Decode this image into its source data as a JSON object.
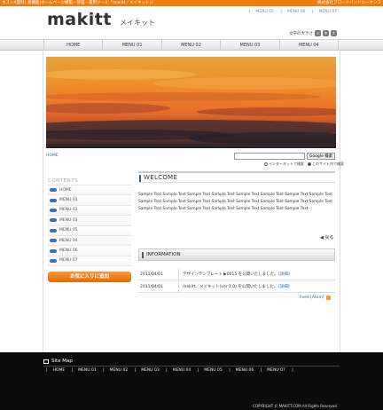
{
  "topbar": {
    "left": "ホスト/(無料) 高機能(ホームページ構築・管理・運用ツール「makitt／メイキット」)",
    "right": "株式会社ブロードバンドシーケンス"
  },
  "header": {
    "logo": "makitt",
    "logo_kana": "メイキット",
    "menu_links": [
      "MENU 05",
      "MENU 06",
      "MENU 07"
    ],
    "font_size_label": "文字の大きさ",
    "font_buttons": [
      "小",
      "中",
      "大"
    ]
  },
  "global_nav": [
    "HOME",
    "MENU 01",
    "MENU 02",
    "MENU 03",
    "MENU 04"
  ],
  "breadcrumb": "HOME",
  "search": {
    "placeholder": "",
    "button": "Google 検索",
    "options": [
      "インターネットで検索",
      "このサイト内で検索"
    ],
    "selected": "このサイト内で検索"
  },
  "sidebar": {
    "heading": "CONTENTS",
    "items": [
      "HOME",
      "MENU 01",
      "MENU 02",
      "MENU 03",
      "MENU 05",
      "MENU 04",
      "MENU 06",
      "MENU 07"
    ],
    "fav_button": "お気に入りに追加"
  },
  "content": {
    "title": "WELCOME",
    "body": "Sample Text Sample Text Sample Text Sample Text Sample Text Sample Text Sample Text Sample Text Sample Text Sample Text Sample Text Sample Text Sample Text Sample Text Sample Text Sample Text Sample Text Sample Text Sample Text Sample Text Sample Text Sample Text Sample Text",
    "back": "◀ 戻る"
  },
  "information": {
    "title": "INFORMATION",
    "items": [
      {
        "date": "2011/04/01",
        "text": "デザインテンプレート ▶0015 を公開いたしました。",
        "link": "《詳細》"
      },
      {
        "date": "2011/04/01",
        "text": "makitt／メイキット(ver 1.0) を公開いたしました。",
        "link": "《詳細》"
      }
    ],
    "feed": "Feed (Atom)"
  },
  "footer": {
    "sitemap": "Site Map",
    "links": [
      "HOME",
      "MENU 01",
      "MENU 02",
      "MENU 03",
      "MENU 04",
      "MENU 05",
      "MENU 06",
      "MENU 07"
    ],
    "copyright": "COPYRIGHT © MAKITT.COM All Rights Reserved."
  },
  "colors": {
    "accent_orange": "#ef7d0e",
    "link_blue": "#3a5fa0",
    "menu_pill": "#3f6fb8",
    "footer_bg": "#0b0b0b"
  }
}
